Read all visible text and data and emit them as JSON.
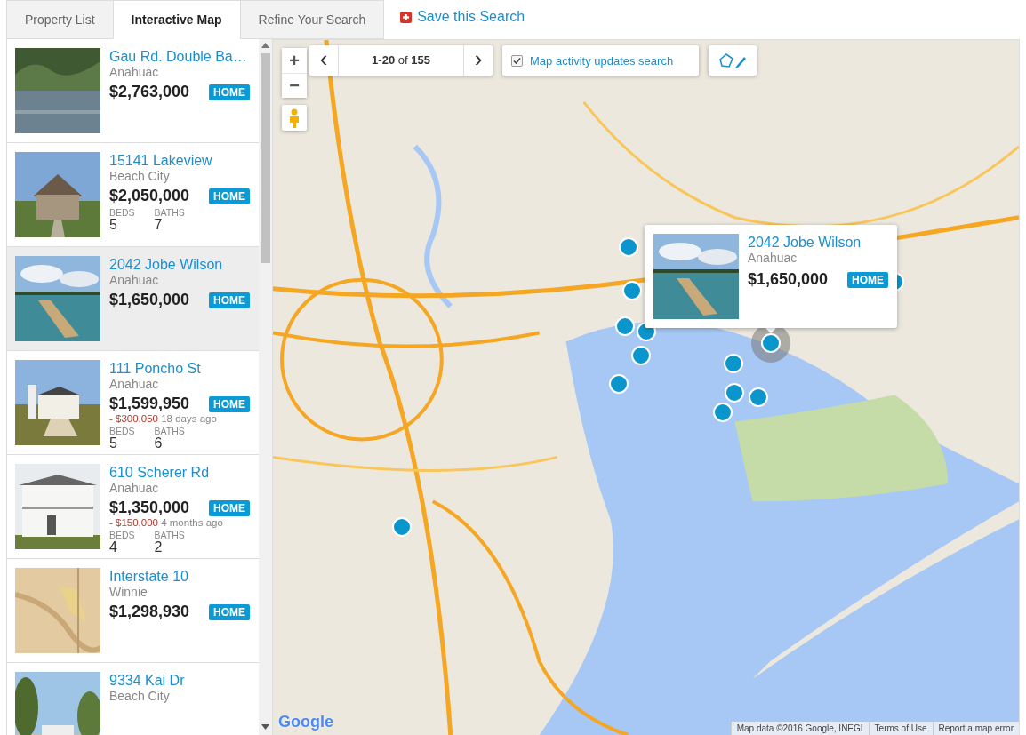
{
  "tabs": [
    {
      "label": "Property List",
      "selected": false
    },
    {
      "label": "Interactive Map",
      "selected": true
    },
    {
      "label": "Refine Your Search",
      "selected": false
    }
  ],
  "save_search": {
    "label": "Save this Search"
  },
  "listings": [
    {
      "title": "Gau Rd. Double Ba…",
      "city": "Anahuac",
      "price": "$2,763,000",
      "badge": "HOME",
      "selected": false
    },
    {
      "title": "15141 Lakeview",
      "city": "Beach City",
      "price": "$2,050,000",
      "badge": "HOME",
      "beds_label": "BEDS",
      "beds": "5",
      "baths_label": "BATHS",
      "baths": "7",
      "selected": false
    },
    {
      "title": "2042 Jobe Wilson",
      "city": "Anahuac",
      "price": "$1,650,000",
      "badge": "HOME",
      "selected": true
    },
    {
      "title": "111 Poncho St",
      "city": "Anahuac",
      "price": "$1,599,950",
      "badge": "HOME",
      "change": "- $300,050",
      "change_age": "18 days ago",
      "beds_label": "BEDS",
      "beds": "5",
      "baths_label": "BATHS",
      "baths": "6",
      "selected": false
    },
    {
      "title": "610 Scherer Rd",
      "city": "Anahuac",
      "price": "$1,350,000",
      "badge": "HOME",
      "change": "- $150,000",
      "change_age": "4 months ago",
      "beds_label": "BEDS",
      "beds": "4",
      "baths_label": "BATHS",
      "baths": "2",
      "selected": false
    },
    {
      "title": "Interstate 10",
      "city": "Winnie",
      "price": "$1,298,930",
      "badge": "HOME",
      "selected": false
    },
    {
      "title": "9334 Kai Dr",
      "city": "Beach City",
      "selected": false
    }
  ],
  "map": {
    "zoom_in": "+",
    "zoom_out": "−",
    "pager": "**1-20** of **155**",
    "prev": "‹",
    "next": "›",
    "update_search": {
      "label": "Map activity updates search",
      "checked": true
    },
    "popup": {
      "title": "2042 Jobe Wilson",
      "city": "Anahuac",
      "price": "$1,650,000",
      "badge": "HOME"
    },
    "logo": "Google",
    "attribution": "Map data ©2016 Google, INEGI",
    "terms": "Terms of Use",
    "report": "Report a map error"
  }
}
